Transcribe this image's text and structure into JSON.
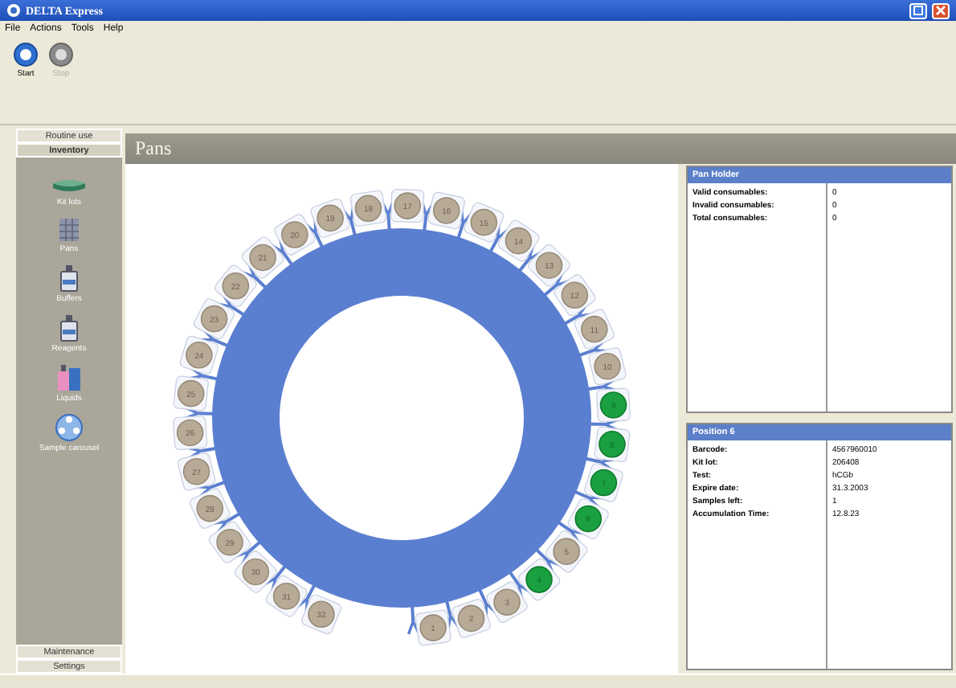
{
  "window": {
    "title": "DELTA Express"
  },
  "menu": [
    "File",
    "Actions",
    "Tools",
    "Help"
  ],
  "toolbar": [
    {
      "label": "Start",
      "kind": "start",
      "disabled": false
    },
    {
      "label": "Stop",
      "kind": "stop",
      "disabled": true
    }
  ],
  "sidebar": {
    "top_tabs": [
      {
        "label": "Routine use",
        "selected": false
      },
      {
        "label": "Inventory",
        "selected": true
      }
    ],
    "items": [
      {
        "label": "Kit lots",
        "kind": "kit"
      },
      {
        "label": "Pans",
        "kind": "pans"
      },
      {
        "label": "Buffers",
        "kind": "bottle"
      },
      {
        "label": "Reagents",
        "kind": "bottle"
      },
      {
        "label": "Liquids",
        "kind": "liquids"
      },
      {
        "label": "Sample carousel",
        "kind": "carousel"
      }
    ],
    "bottom_tabs": [
      {
        "label": "Maintenance",
        "selected": false
      },
      {
        "label": "Settings",
        "selected": false
      }
    ]
  },
  "header": {
    "title": "Pans"
  },
  "carousel": {
    "right_arc": [
      {
        "label": "17",
        "loaded": false
      },
      {
        "label": "16",
        "loaded": false
      },
      {
        "label": "15",
        "loaded": false
      },
      {
        "label": "14",
        "loaded": false
      },
      {
        "label": "13",
        "loaded": false
      },
      {
        "label": "12",
        "loaded": false
      },
      {
        "label": "11",
        "loaded": false
      },
      {
        "label": "10",
        "loaded": false
      },
      {
        "label": "9",
        "loaded": true
      },
      {
        "label": "8",
        "loaded": true
      },
      {
        "label": "7",
        "loaded": true
      },
      {
        "label": "6",
        "loaded": true
      },
      {
        "label": "5",
        "loaded": false
      },
      {
        "label": "4",
        "loaded": true
      },
      {
        "label": "3",
        "loaded": false
      },
      {
        "label": "2",
        "loaded": false
      },
      {
        "label": "1",
        "loaded": false
      }
    ],
    "left_arc": [
      {
        "label": "18",
        "loaded": false
      },
      {
        "label": "19",
        "loaded": false
      },
      {
        "label": "20",
        "loaded": false
      },
      {
        "label": "21",
        "loaded": false
      },
      {
        "label": "22",
        "loaded": false
      },
      {
        "label": "23",
        "loaded": false
      },
      {
        "label": "24",
        "loaded": false
      },
      {
        "label": "25",
        "loaded": false
      },
      {
        "label": "26",
        "loaded": false
      },
      {
        "label": "27",
        "loaded": false
      },
      {
        "label": "28",
        "loaded": false
      },
      {
        "label": "29",
        "loaded": false
      },
      {
        "label": "30",
        "loaded": false
      },
      {
        "label": "31",
        "loaded": false
      },
      {
        "label": "32",
        "loaded": false
      }
    ]
  },
  "panels": [
    {
      "title": "Pan Holder",
      "rows": [
        {
          "label": "Valid consumables:",
          "value": "0"
        },
        {
          "label": "Invalid consumables:",
          "value": "0"
        },
        {
          "label": "Total consumables:",
          "value": "0"
        }
      ]
    },
    {
      "title": "Position 6",
      "rows": [
        {
          "label": "Barcode:",
          "value": "4567960010"
        },
        {
          "label": "Kit lot:",
          "value": "206408"
        },
        {
          "label": "Test:",
          "value": "hCGb"
        },
        {
          "label": "Expire date:",
          "value": "31.3.2003"
        },
        {
          "label": "Samples left:",
          "value": "1"
        },
        {
          "label": "Accumulation Time:",
          "value": "12.8.23"
        }
      ]
    }
  ]
}
